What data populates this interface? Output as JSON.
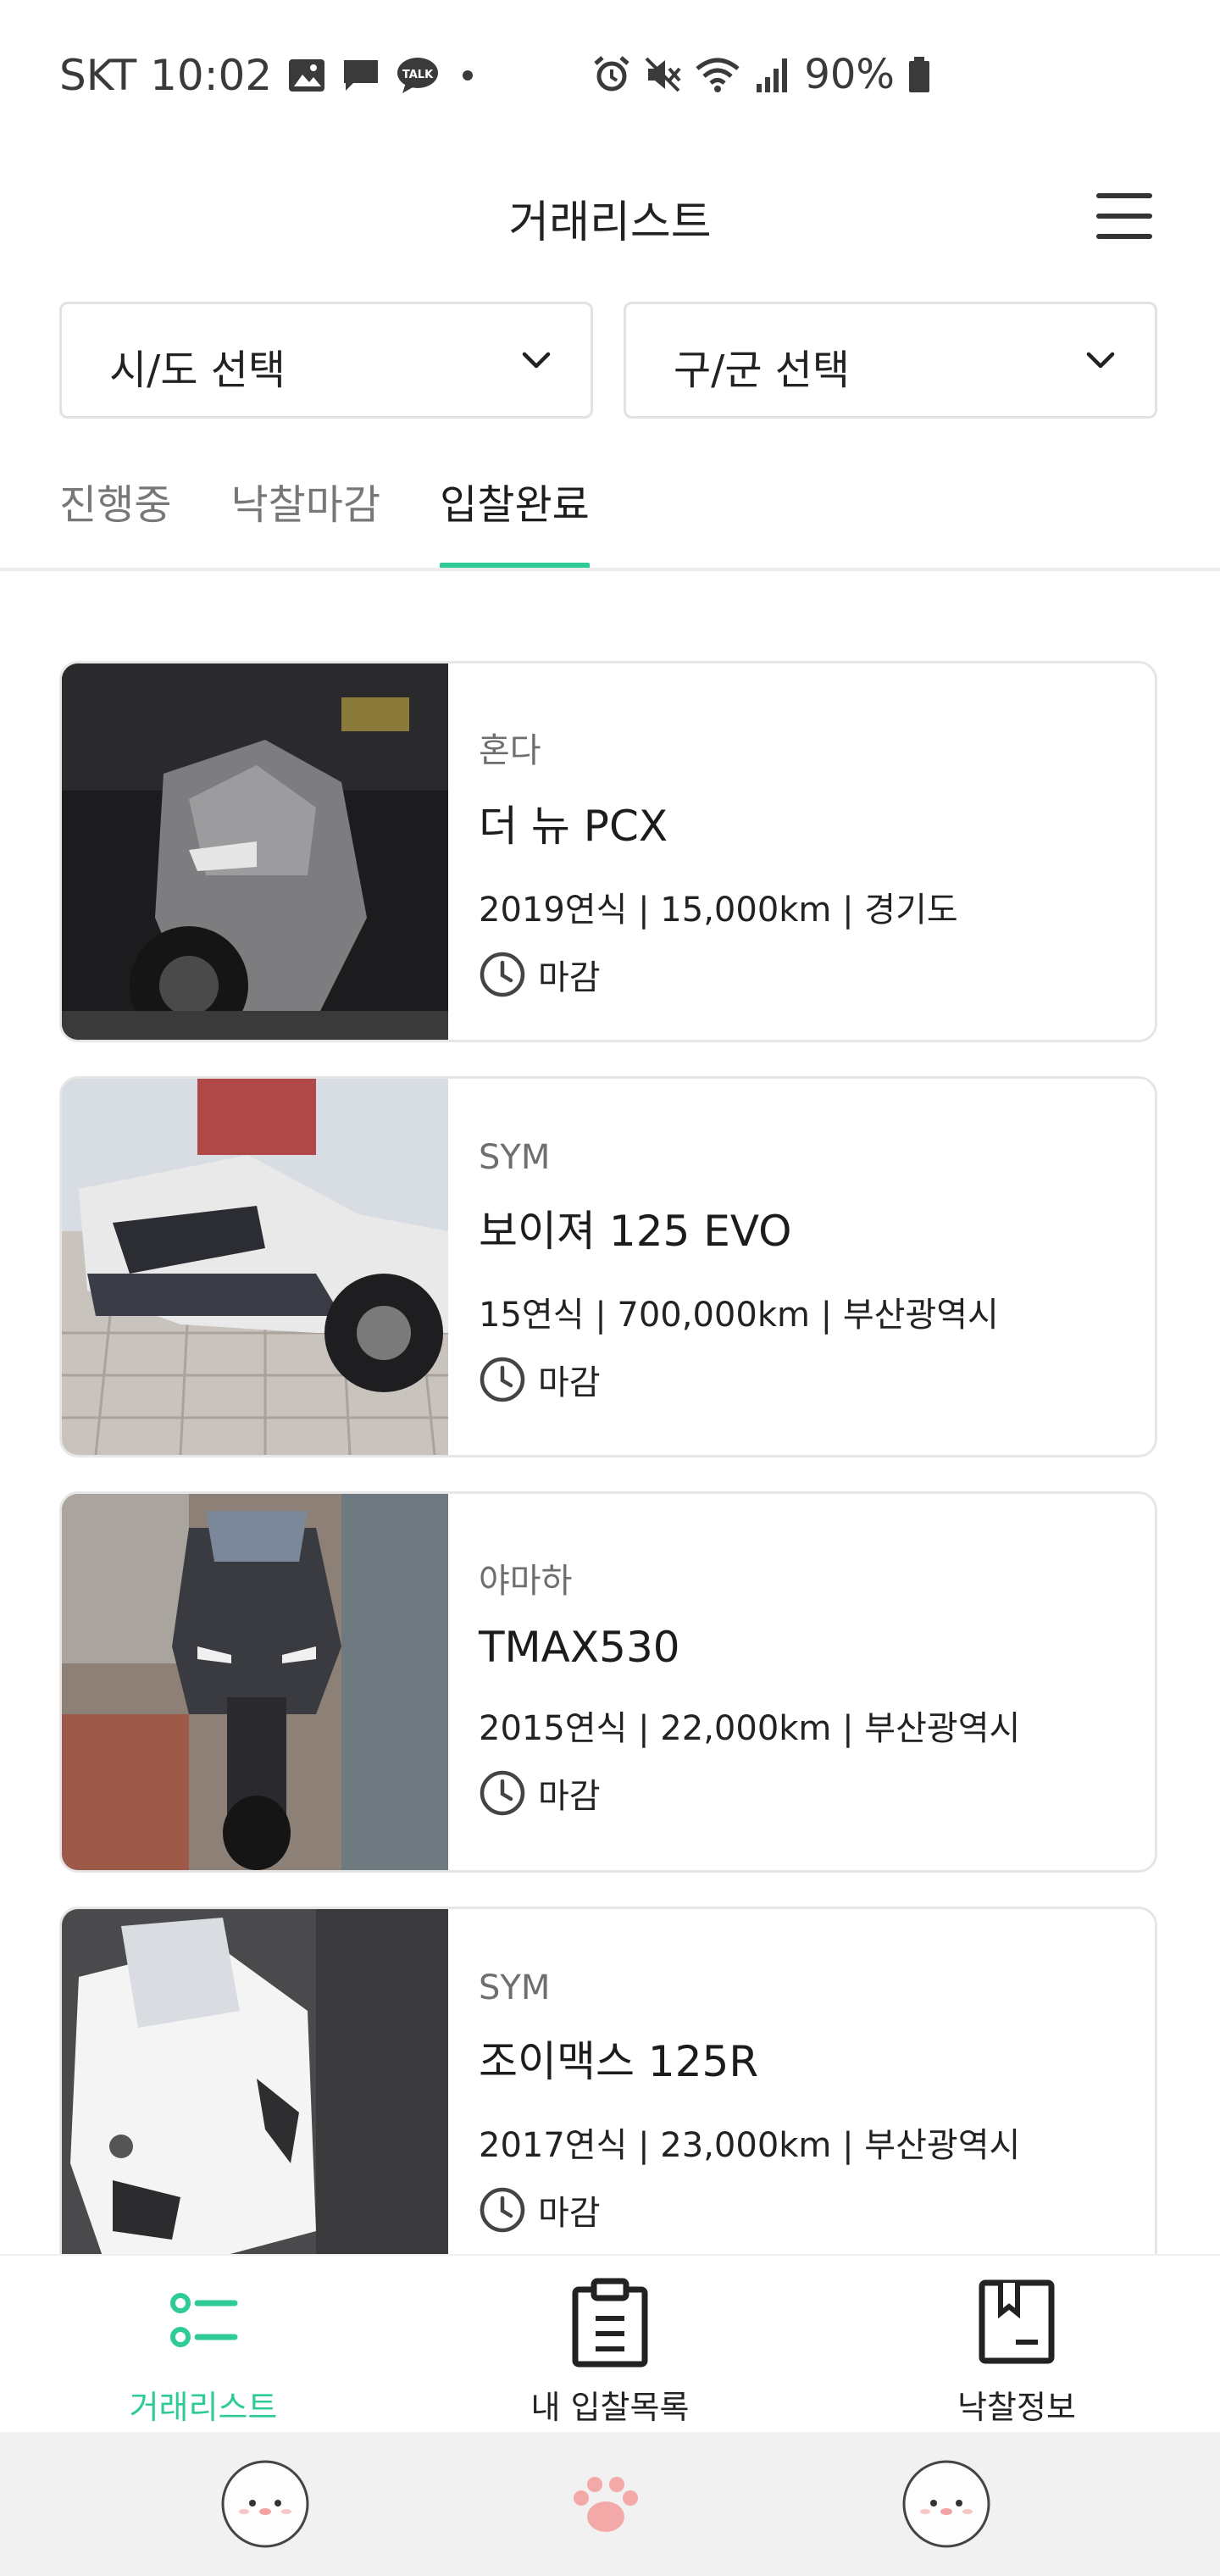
{
  "status_bar": {
    "carrier_time": "SKT 10:02",
    "battery": "90%",
    "left_icons": [
      "gallery-icon",
      "message-icon",
      "kakaotalk-icon",
      "dot-icon"
    ],
    "right_icons": [
      "alarm-icon",
      "mute-icon",
      "wifi-icon",
      "signal-icon",
      "battery-icon"
    ]
  },
  "header": {
    "title": "거래리스트"
  },
  "filters": {
    "region": "시/도 선택",
    "district": "구/군 선택"
  },
  "tabs": [
    {
      "label": "진행중",
      "active": false
    },
    {
      "label": "낙찰마감",
      "active": false
    },
    {
      "label": "입찰완료",
      "active": true
    }
  ],
  "listings": [
    {
      "brand": "혼다",
      "model": "더 뉴 PCX",
      "meta": "2019연식 | 15,000km | 경기도",
      "status": "마감"
    },
    {
      "brand": "SYM",
      "model": "보이져 125 EVO",
      "meta": "15연식 | 700,000km | 부산광역시",
      "status": "마감"
    },
    {
      "brand": "야마하",
      "model": "TMAX530",
      "meta": "2015연식 | 22,000km | 부산광역시",
      "status": "마감"
    },
    {
      "brand": "SYM",
      "model": "조이맥스 125R",
      "meta": "2017연식 | 23,000km | 부산광역시",
      "status": "마감"
    }
  ],
  "bottom_nav": [
    {
      "label": "거래리스트",
      "icon": "list-icon",
      "active": true
    },
    {
      "label": "내 입찰목록",
      "icon": "clipboard-icon",
      "active": false
    },
    {
      "label": "낙찰정보",
      "icon": "bookmark-book-icon",
      "active": false
    }
  ],
  "colors": {
    "accent": "#2ecb98",
    "text": "#222222",
    "muted": "#777777",
    "border": "#e6e6e6"
  }
}
